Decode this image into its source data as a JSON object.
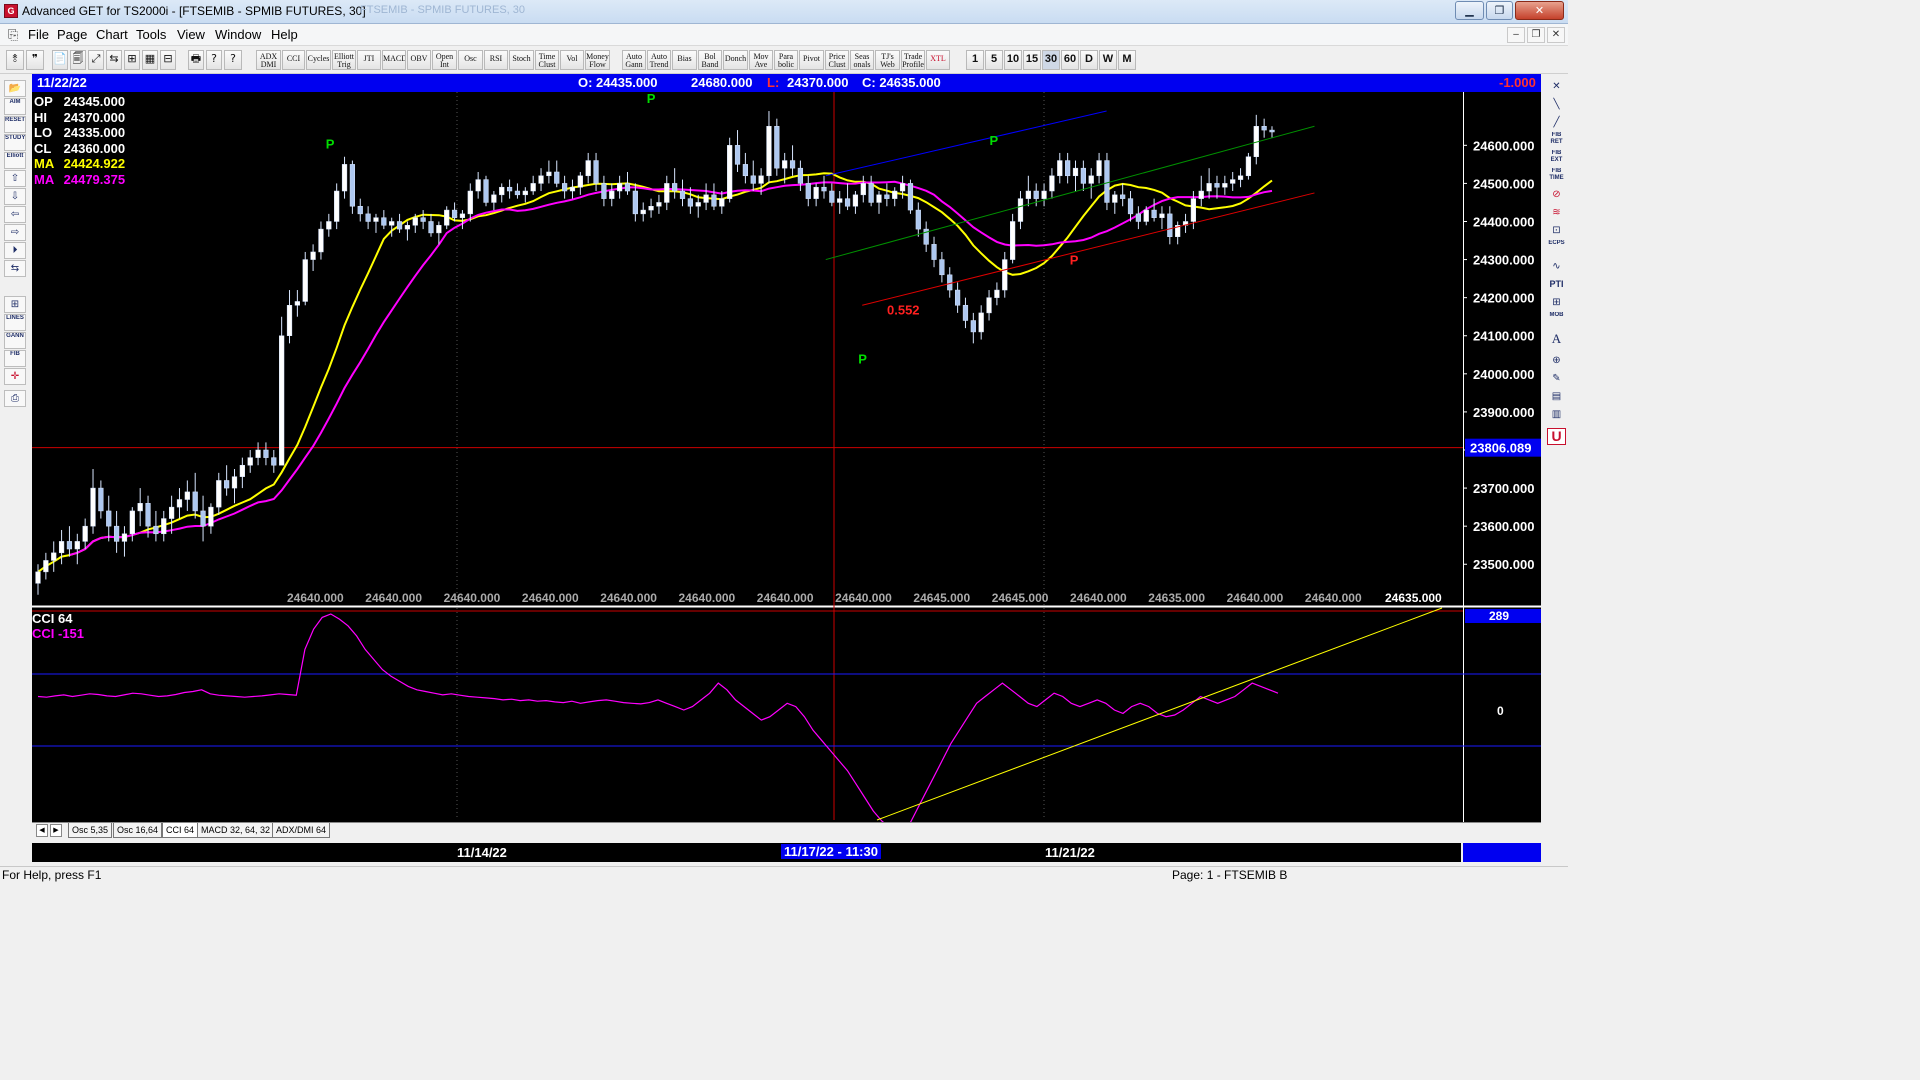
{
  "window": {
    "title": "Advanced GET for TS2000i - [FTSEMIB - SPMIB FUTURES, 30]",
    "ghost_title": "FTSEMIB - SPMIB FUTURES, 30",
    "app_icon": "ag-app-icon",
    "buttons": {
      "minimize": "▁",
      "maximize": "❐",
      "close": "✕"
    }
  },
  "menu": {
    "items": [
      "File",
      "Page",
      "Chart",
      "Tools",
      "View",
      "Window",
      "Help"
    ],
    "mdi_buttons": {
      "minimize": "‒",
      "restore": "❐",
      "close": "✕"
    }
  },
  "toolbar": {
    "file_icons": [
      "📄",
      "🗐",
      "⤢",
      "⇆",
      "⊞",
      "▦",
      "⊟",
      "🖶",
      "?",
      "?"
    ],
    "studies": [
      "ADX DMI",
      "CCI",
      "Cycles",
      "Elliott Trig",
      "JTI",
      "MACD",
      "OBV",
      "Open Int",
      "Osc",
      "RSI",
      "Stoch",
      "Time Clust",
      "Vol",
      "Money Flow",
      "Auto Gann",
      "Auto Trend",
      "Bias",
      "Bol Band",
      "Donch",
      "Mov Ave",
      "Para bolic",
      "Pivot",
      "Price Clust",
      "Seas onals",
      "TJ's Web",
      "Trade Profile",
      "XTL"
    ],
    "intervals": [
      "1",
      "5",
      "10",
      "15",
      "30",
      "60",
      "D",
      "W",
      "M"
    ],
    "selected_interval": "30"
  },
  "infobar": {
    "date": "11/22/22",
    "open": "O: 24435.000",
    "high": "24680.000",
    "low_label": "L:",
    "low": "24370.000",
    "close": "C: 24635.000",
    "change": "-1.000"
  },
  "ohlc_panel": {
    "op": {
      "label": "OP",
      "value": "24345.000"
    },
    "hi": {
      "label": "HI",
      "value": "24370.000"
    },
    "lo": {
      "label": "LO",
      "value": "24335.000"
    },
    "cl": {
      "label": "CL",
      "value": "24360.000"
    },
    "ma1": {
      "label": "MA",
      "value": "24424.922"
    },
    "ma2": {
      "label": "MA",
      "value": "24479.375"
    }
  },
  "chart_data": {
    "type": "candlestick",
    "symbol": "FTSEMIB - SPMIB FUTURES",
    "interval_minutes": 30,
    "price_axis": {
      "ticks": [
        "24600.000",
        "24500.000",
        "24400.000",
        "24300.000",
        "24200.000",
        "24100.000",
        "24000.000",
        "23900.000",
        "23800.000",
        "23700.000",
        "23600.000",
        "23500.000"
      ],
      "range": [
        23393,
        24740
      ],
      "highlight_level": "23806.089",
      "highlight_value": 23806.089
    },
    "bottom_price_labels": [
      "24640.000",
      "24640.000",
      "24640.000",
      "24640.000",
      "24640.000",
      "24640.000",
      "24640.000",
      "24640.000",
      "24645.000",
      "24645.000",
      "24640.000",
      "24635.000",
      "24640.000",
      "24640.000"
    ],
    "bottom_price_label_right": "24635.000",
    "pivot_label": "P",
    "pivot_points": [
      {
        "bar": 80,
        "type": "high",
        "price": 24570
      },
      {
        "bar": 168,
        "type": "high",
        "price": 24690
      },
      {
        "bar": 226,
        "type": "low",
        "price": 24080
      },
      {
        "bar": 262,
        "type": "high",
        "price": 24580
      },
      {
        "bar": 284,
        "type": "low",
        "price": 24340
      }
    ],
    "ratio_label": "0.552",
    "ratio_label_price": 24140,
    "cursor_bar": 201,
    "series": [
      {
        "name": "MA",
        "value": "24424.922",
        "color": "#ffff00"
      },
      {
        "name": "MA",
        "value": "24479.375",
        "color": "#ff00ff"
      }
    ],
    "trend_lines": [
      {
        "color": "#0000ff",
        "from": {
          "bar": 216,
          "price": 24520
        },
        "to": {
          "bar": 293,
          "price": 24690
        }
      },
      {
        "color": "#009000",
        "from": {
          "bar": 216,
          "price": 24300
        },
        "to": {
          "bar": 350,
          "price": 24650
        }
      },
      {
        "color": "#dd0000",
        "from": {
          "bar": 226,
          "price": 24180
        },
        "to": {
          "bar": 350,
          "price": 24475
        }
      }
    ],
    "candles": [
      [
        23450,
        23500,
        23420,
        23480
      ],
      [
        23480,
        23530,
        23460,
        23510
      ],
      [
        23510,
        23560,
        23480,
        23530
      ],
      [
        23530,
        23590,
        23500,
        23560
      ],
      [
        23560,
        23600,
        23520,
        23540
      ],
      [
        23540,
        23580,
        23500,
        23560
      ],
      [
        23560,
        23620,
        23540,
        23600
      ],
      [
        23600,
        23750,
        23580,
        23700
      ],
      [
        23700,
        23720,
        23620,
        23640
      ],
      [
        23640,
        23680,
        23560,
        23600
      ],
      [
        23600,
        23640,
        23530,
        23560
      ],
      [
        23560,
        23600,
        23520,
        23580
      ],
      [
        23580,
        23650,
        23560,
        23640
      ],
      [
        23640,
        23700,
        23600,
        23660
      ],
      [
        23660,
        23680,
        23570,
        23600
      ],
      [
        23600,
        23640,
        23560,
        23580
      ],
      [
        23580,
        23640,
        23560,
        23620
      ],
      [
        23620,
        23680,
        23580,
        23650
      ],
      [
        23650,
        23700,
        23620,
        23670
      ],
      [
        23670,
        23720,
        23640,
        23690
      ],
      [
        23690,
        23740,
        23620,
        23640
      ],
      [
        23640,
        23680,
        23560,
        23600
      ],
      [
        23600,
        23660,
        23580,
        23650
      ],
      [
        23650,
        23740,
        23630,
        23720
      ],
      [
        23720,
        23760,
        23680,
        23700
      ],
      [
        23700,
        23750,
        23660,
        23730
      ],
      [
        23730,
        23780,
        23700,
        23760
      ],
      [
        23760,
        23800,
        23740,
        23780
      ],
      [
        23780,
        23820,
        23760,
        23800
      ],
      [
        23800,
        23820,
        23760,
        23780
      ],
      [
        23780,
        23800,
        23740,
        23760
      ],
      [
        23760,
        24150,
        23760,
        24100
      ],
      [
        24100,
        24220,
        24080,
        24180
      ],
      [
        24180,
        24220,
        24150,
        24190
      ],
      [
        24190,
        24320,
        24180,
        24300
      ],
      [
        24300,
        24340,
        24270,
        24320
      ],
      [
        24320,
        24400,
        24300,
        24380
      ],
      [
        24380,
        24420,
        24360,
        24400
      ],
      [
        24400,
        24500,
        24380,
        24480
      ],
      [
        24480,
        24570,
        24460,
        24550
      ],
      [
        24550,
        24560,
        24420,
        24440
      ],
      [
        24440,
        24460,
        24400,
        24420
      ],
      [
        24420,
        24440,
        24380,
        24400
      ],
      [
        24400,
        24420,
        24370,
        24410
      ],
      [
        24410,
        24430,
        24380,
        24390
      ],
      [
        24390,
        24410,
        24360,
        24400
      ],
      [
        24400,
        24420,
        24370,
        24380
      ],
      [
        24380,
        24400,
        24350,
        24390
      ],
      [
        24390,
        24420,
        24370,
        24410
      ],
      [
        24410,
        24430,
        24380,
        24400
      ],
      [
        24400,
        24420,
        24360,
        24370
      ],
      [
        24370,
        24400,
        24340,
        24390
      ],
      [
        24390,
        24440,
        24380,
        24430
      ],
      [
        24430,
        24450,
        24400,
        24410
      ],
      [
        24410,
        24430,
        24380,
        24420
      ],
      [
        24420,
        24500,
        24400,
        24480
      ],
      [
        24480,
        24530,
        24460,
        24510
      ],
      [
        24510,
        24520,
        24440,
        24450
      ],
      [
        24450,
        24480,
        24430,
        24470
      ],
      [
        24470,
        24500,
        24450,
        24490
      ],
      [
        24490,
        24510,
        24460,
        24480
      ],
      [
        24480,
        24500,
        24460,
        24470
      ],
      [
        24470,
        24490,
        24450,
        24480
      ],
      [
        24480,
        24520,
        24470,
        24500
      ],
      [
        24500,
        24540,
        24480,
        24520
      ],
      [
        24520,
        24560,
        24500,
        24530
      ],
      [
        24530,
        24560,
        24490,
        24500
      ],
      [
        24500,
        24520,
        24460,
        24480
      ],
      [
        24480,
        24510,
        24460,
        24490
      ],
      [
        24490,
        24530,
        24470,
        24520
      ],
      [
        24520,
        24580,
        24500,
        24560
      ],
      [
        24560,
        24580,
        24480,
        24500
      ],
      [
        24500,
        24520,
        24440,
        24460
      ],
      [
        24460,
        24500,
        24440,
        24480
      ],
      [
        24480,
        24520,
        24460,
        24500
      ],
      [
        24500,
        24530,
        24470,
        24480
      ],
      [
        24480,
        24500,
        24400,
        24420
      ],
      [
        24420,
        24450,
        24400,
        24430
      ],
      [
        24430,
        24460,
        24410,
        24440
      ],
      [
        24440,
        24470,
        24420,
        24450
      ],
      [
        24450,
        24520,
        24430,
        24500
      ],
      [
        24500,
        24540,
        24460,
        24480
      ],
      [
        24480,
        24510,
        24440,
        24460
      ],
      [
        24460,
        24490,
        24420,
        24440
      ],
      [
        24440,
        24470,
        24410,
        24450
      ],
      [
        24450,
        24500,
        24430,
        24470
      ],
      [
        24470,
        24500,
        24430,
        24440
      ],
      [
        24440,
        24480,
        24420,
        24460
      ],
      [
        24460,
        24620,
        24450,
        24600
      ],
      [
        24600,
        24640,
        24530,
        24550
      ],
      [
        24550,
        24580,
        24500,
        24520
      ],
      [
        24520,
        24560,
        24480,
        24500
      ],
      [
        24500,
        24540,
        24470,
        24520
      ],
      [
        24520,
        24690,
        24500,
        24650
      ],
      [
        24650,
        24670,
        24520,
        24540
      ],
      [
        24540,
        24580,
        24500,
        24560
      ],
      [
        24560,
        24600,
        24520,
        24540
      ],
      [
        24540,
        24560,
        24480,
        24500
      ],
      [
        24500,
        24520,
        24440,
        24460
      ],
      [
        24460,
        24500,
        24440,
        24490
      ],
      [
        24490,
        24520,
        24460,
        24480
      ],
      [
        24480,
        24500,
        24440,
        24450
      ],
      [
        24450,
        24480,
        24420,
        24460
      ],
      [
        24460,
        24500,
        24430,
        24440
      ],
      [
        24440,
        24480,
        24420,
        24470
      ],
      [
        24470,
        24520,
        24450,
        24500
      ],
      [
        24500,
        24520,
        24440,
        24450
      ],
      [
        24450,
        24480,
        24420,
        24470
      ],
      [
        24470,
        24500,
        24440,
        24460
      ],
      [
        24460,
        24490,
        24440,
        24480
      ],
      [
        24480,
        24520,
        24460,
        24500
      ],
      [
        24500,
        24510,
        24420,
        24430
      ],
      [
        24430,
        24450,
        24360,
        24380
      ],
      [
        24380,
        24400,
        24320,
        24340
      ],
      [
        24340,
        24360,
        24280,
        24300
      ],
      [
        24300,
        24320,
        24240,
        24260
      ],
      [
        24260,
        24280,
        24200,
        24220
      ],
      [
        24220,
        24240,
        24160,
        24180
      ],
      [
        24180,
        24200,
        24120,
        24140
      ],
      [
        24140,
        24160,
        24080,
        24110
      ],
      [
        24110,
        24180,
        24090,
        24160
      ],
      [
        24160,
        24220,
        24140,
        24200
      ],
      [
        24200,
        24240,
        24180,
        24220
      ],
      [
        24220,
        24320,
        24200,
        24300
      ],
      [
        24300,
        24420,
        24290,
        24400
      ],
      [
        24400,
        24480,
        24380,
        24460
      ],
      [
        24460,
        24520,
        24440,
        24480
      ],
      [
        24480,
        24500,
        24440,
        24460
      ],
      [
        24460,
        24500,
        24440,
        24480
      ],
      [
        24480,
        24540,
        24460,
        24520
      ],
      [
        24520,
        24580,
        24500,
        24560
      ],
      [
        24560,
        24580,
        24500,
        24520
      ],
      [
        24520,
        24560,
        24480,
        24540
      ],
      [
        24540,
        24560,
        24480,
        24500
      ],
      [
        24500,
        24540,
        24460,
        24520
      ],
      [
        24520,
        24580,
        24500,
        24560
      ],
      [
        24560,
        24580,
        24430,
        24450
      ],
      [
        24450,
        24480,
        24420,
        24470
      ],
      [
        24470,
        24500,
        24440,
        24460
      ],
      [
        24460,
        24480,
        24400,
        24420
      ],
      [
        24420,
        24440,
        24380,
        24400
      ],
      [
        24400,
        24440,
        24390,
        24430
      ],
      [
        24430,
        24460,
        24400,
        24410
      ],
      [
        24410,
        24440,
        24380,
        24420
      ],
      [
        24420,
        24440,
        24340,
        24360
      ],
      [
        24360,
        24400,
        24340,
        24390
      ],
      [
        24390,
        24420,
        24370,
        24400
      ],
      [
        24400,
        24480,
        24380,
        24460
      ],
      [
        24460,
        24520,
        24440,
        24480
      ],
      [
        24480,
        24540,
        24460,
        24500
      ],
      [
        24500,
        24520,
        24460,
        24490
      ],
      [
        24490,
        24520,
        24470,
        24500
      ],
      [
        24500,
        24530,
        24480,
        24510
      ],
      [
        24510,
        24540,
        24490,
        24520
      ],
      [
        24520,
        24580,
        24510,
        24570
      ],
      [
        24570,
        24680,
        24550,
        24650
      ],
      [
        24650,
        24670,
        24620,
        24640
      ],
      [
        24640,
        24650,
        24620,
        24635
      ]
    ]
  },
  "cci_panel": {
    "title": "CCI 64",
    "value_label": "CCI",
    "value": "-151",
    "axis_top": "289",
    "axis_zero": "0",
    "line_color": "#ff00ff",
    "trendline_color": "#ffff00",
    "values": [
      40,
      38,
      42,
      45,
      40,
      44,
      48,
      46,
      42,
      40,
      45,
      50,
      48,
      44,
      40,
      42,
      46,
      52,
      55,
      60,
      48,
      44,
      42,
      40,
      38,
      40,
      42,
      45,
      48,
      46,
      44,
      180,
      240,
      275,
      285,
      270,
      250,
      220,
      180,
      150,
      120,
      100,
      85,
      70,
      60,
      55,
      50,
      45,
      48,
      44,
      40,
      38,
      36,
      34,
      30,
      32,
      28,
      30,
      26,
      28,
      24,
      22,
      26,
      20,
      24,
      28,
      30,
      26,
      22,
      20,
      18,
      22,
      30,
      20,
      10,
      0,
      10,
      30,
      50,
      80,
      60,
      30,
      10,
      -10,
      -30,
      -20,
      0,
      20,
      10,
      -20,
      -60,
      -90,
      -120,
      -150,
      -180,
      -220,
      -260,
      -300,
      -330,
      -350,
      -380,
      -350,
      -300,
      -250,
      -200,
      -150,
      -100,
      -60,
      -20,
      20,
      40,
      60,
      80,
      60,
      40,
      20,
      10,
      30,
      50,
      40,
      20,
      10,
      20,
      30,
      20,
      0,
      -10,
      10,
      20,
      10,
      -10,
      -20,
      -15,
      0,
      20,
      40,
      30,
      20,
      30,
      40,
      60,
      80,
      70,
      60,
      50
    ]
  },
  "tabs": {
    "items": [
      "Osc 5,35",
      "Osc 16,64",
      "CCI 64",
      "MACD 32, 64, 32",
      "ADX/DMI 64"
    ],
    "active": "CCI 64",
    "arrows": [
      "◀",
      "▶"
    ]
  },
  "datebar": {
    "left": "11/14/22",
    "center": "11/17/22 - 11:30",
    "right": "11/21/22"
  },
  "status": {
    "help": "For Help, press F1",
    "page": "Page: 1 - FTSEMIB B"
  },
  "left_tools": [
    "📂",
    "AIM",
    "RESET",
    "STUDY",
    "Elliott",
    "⇧",
    "⇩",
    "⇦",
    "⇨",
    "⏵",
    "⇆",
    "⊞",
    "LINES",
    "GANN",
    "FIB",
    "✛",
    "⎙"
  ],
  "right_tools": [
    "✕",
    "╲",
    "╱",
    "FIB RET",
    "FIB EXT",
    "FIB TIME",
    "⊘",
    "≋",
    "⊡",
    "ECPS",
    "∿",
    "PTI",
    "⊞",
    "MOB",
    "A",
    "⊕",
    "✎",
    "▤",
    "▥",
    "U"
  ]
}
